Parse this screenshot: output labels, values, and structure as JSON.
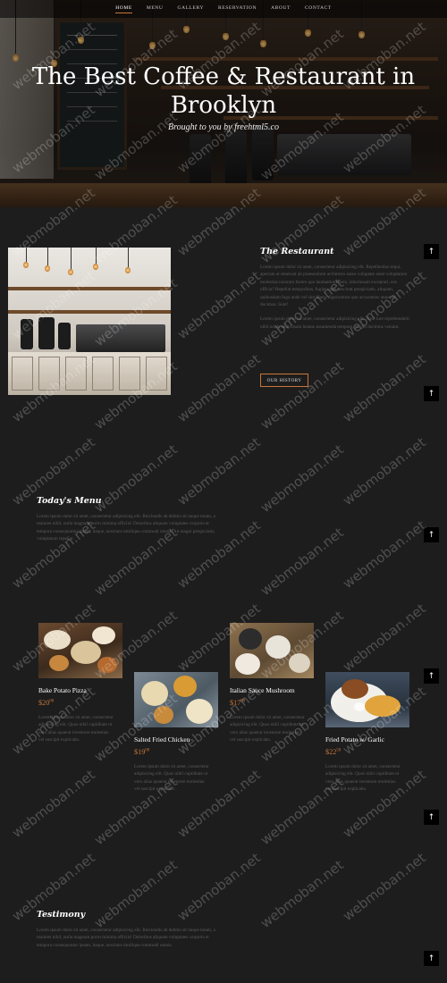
{
  "nav": {
    "items": [
      "HOME",
      "MENU",
      "GALLERY",
      "RESERVATION",
      "ABOUT",
      "CONTACT"
    ],
    "active": "HOME"
  },
  "hero": {
    "title_line1": "The Best Coffee & Restaurant in",
    "title_line2": "Brooklyn",
    "subtitle": "Brought to you by freehtml5.co"
  },
  "restaurant": {
    "heading": "The Restaurant",
    "para1": "Lorem ipsum dolor sit amet, consectetur adipisicing elit. Repellendus sequi, aperiam at deserunt ab praesentium architecto natus voluptate amet voluptatum molestiae nostrum facere quo laudantium iusto, laboriosam excepturi, eos officia? Repellat temporibus, fugiat vitae nesciunt perspiciatis, aliquam, quibusdam fuga unde vel sint libero dignissimos quo accusamus atque et ducimus. Sunt!",
    "para2": "Lorem ipsum dolor sit amet, consectetur adipisicing elit. Nam iure reprehenderit nihil nobis laboriosam beatae assumenda tempore, magni ducimus veniam.",
    "button": "OUR HISTORY"
  },
  "menu": {
    "heading": "Today's Menu",
    "intro": "Lorem ipsum dolor sit amet, consectetur adipisicing elit. Reiciendis ab debitis sit itaque totam, a maiores nihil, nulla magnam porro minima officiis! Doloribus aliquam voluptates corporis et tempora consequuntur ipsam, itaque, nesciunt similique commodi omnis. Ad magni perspiciatis, voluptatum repellat.",
    "items": [
      {
        "name": "Bake Potato Pizza",
        "price_whole": "$20",
        "price_cents": "00",
        "desc": "Lorem ipsum dolor sit amet, consectetur adipisicing elit. Quos nihil cupiditate ut vero alias quaerat inventore molestias vel suscipit explicabo."
      },
      {
        "name": "Salted Fried Chicken",
        "price_whole": "$19",
        "price_cents": "00",
        "desc": "Lorem ipsum dolor sit amet, consectetur adipisicing elit. Quos nihil cupiditate ut vero alias quaerat inventore molestias vel suscipit explicabo."
      },
      {
        "name": "Italian Sauce Mushroom",
        "price_whole": "$17",
        "price_cents": "99",
        "desc": "Lorem ipsum dolor sit amet, consectetur adipisicing elit. Quos nihil cupiditate ut vero alias quaerat inventore molestias vel suscipit explicabo."
      },
      {
        "name": "Fried Potato w/ Garlic",
        "price_whole": "$22",
        "price_cents": "50",
        "desc": "Lorem ipsum dolor sit amet, consectetur adipisicing elit. Quos nihil cupiditate ut vero alias quaerat inventore molestias vel suscipit explicabo."
      }
    ]
  },
  "testimony": {
    "heading": "Testimony",
    "text": "Lorem ipsum dolor sit amet, consectetur adipisicing elit. Reiciendis ab debitis sit itaque totam, a maiores nihil, nulla magnam porro minima officiis! Doloribus aliquam voluptates corporis et tempora consequuntur ipsam, itaque, nesciunt similique commodi omnis."
  },
  "back_to_top_glyph": "↑",
  "watermark": "webmoban.net",
  "colors": {
    "accent": "#c8763a",
    "background": "#1d1d1d",
    "muted_text": "#5d5d5d"
  }
}
